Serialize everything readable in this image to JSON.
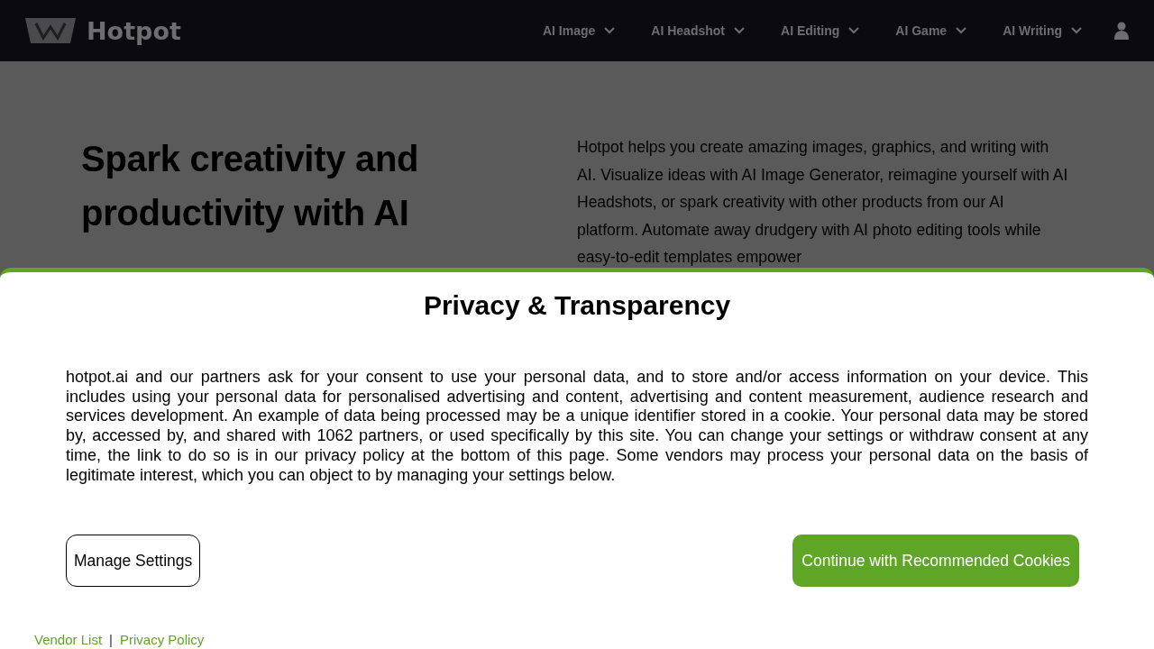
{
  "header": {
    "logo_text": "Hotpot",
    "nav": [
      {
        "label": "AI Image"
      },
      {
        "label": "AI Headshot"
      },
      {
        "label": "AI Editing"
      },
      {
        "label": "AI Game"
      },
      {
        "label": "AI Writing"
      }
    ]
  },
  "hero": {
    "heading": "Spark creativity and productivity with AI",
    "description": "Hotpot helps you create amazing images, graphics, and writing with AI. Visualize ideas with AI Image Generator, reimagine yourself with AI Headshots, or spark creativity with other products from our AI platform. Automate away drudgery with AI photo editing tools while easy-to-edit templates empower"
  },
  "consent_dialog": {
    "title": "Privacy & Transparency",
    "body": "hotpot.ai and our partners ask for your consent to use your personal data, and to store and/or access information on your device. This includes using your personal data for personalised advertising and content, advertising and content measurement, audience research and services development. An example of data being processed may be a unique identifier stored in a cookie. Your personal data may be stored by, accessed by, and shared with 1062 partners, or used specifically by this site. You can change your settings or withdraw consent at any time, the link to do so is in our privacy policy at the bottom of this page. Some vendors may process your personal data on the basis of legitimate interest, which you can object to by managing your settings below.",
    "buttons": [
      {
        "label": "Manage Settings",
        "kind": "outline"
      },
      {
        "label": "Continue with Recommended Cookies",
        "kind": "primary"
      }
    ],
    "footer_links": [
      "Vendor List",
      "Privacy Policy"
    ],
    "separator": "|"
  }
}
